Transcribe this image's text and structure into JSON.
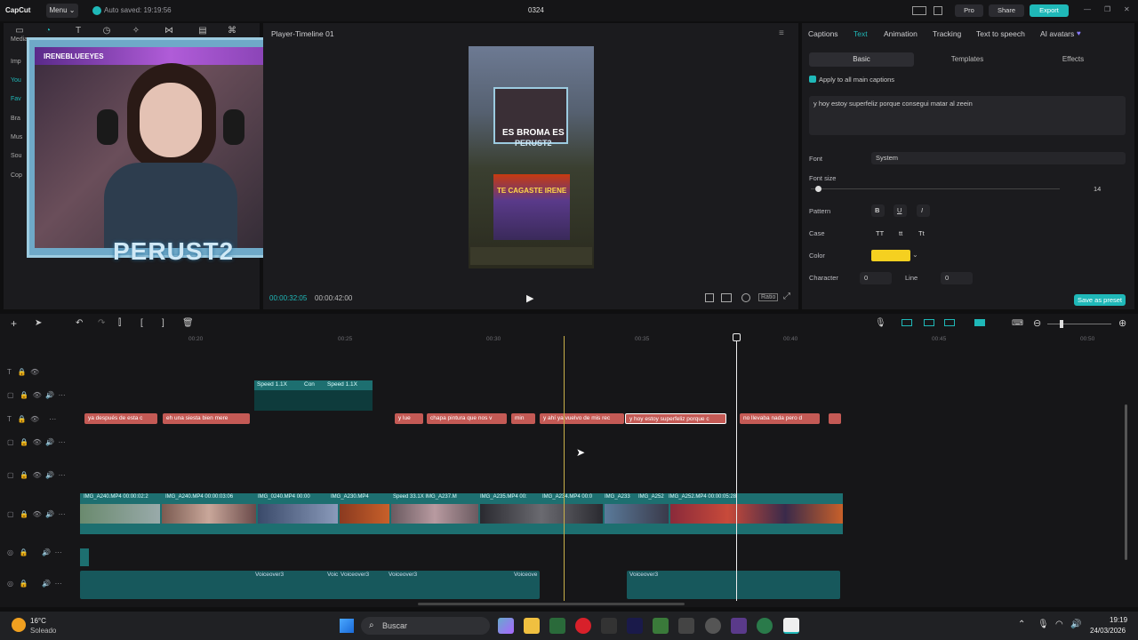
{
  "titlebar": {
    "app_name": "CapCut",
    "menu_label": "Menu",
    "autosave": "Auto saved: 19:19:56",
    "project_name": "0324",
    "pro_label": "Pro",
    "share_label": "Share",
    "export_label": "Export"
  },
  "media_panel": {
    "tab_label": "Media",
    "side_items": [
      "Imp",
      "You",
      "Fav",
      "Bra",
      "Mus",
      "Sou",
      "Cop"
    ]
  },
  "overlay": {
    "streamer_handle": "IRENEBLUEEYES",
    "overlay_title": "PERUST2"
  },
  "player": {
    "title": "Player-Timeline 01",
    "current_time": "00:00:32:05",
    "total_time": "00:00:42:00",
    "ratio_label": "Ratio",
    "caption_top": "ES BROMA ES",
    "caption_mid": "PERUST2",
    "caption_fire": "TE CAGASTE IRENE"
  },
  "right_panel": {
    "tabs": [
      "Captions",
      "Text",
      "Animation",
      "Tracking",
      "Text to speech",
      "AI avatars"
    ],
    "active_tab": "Text",
    "subtabs": [
      "Basic",
      "Templates",
      "Effects"
    ],
    "apply_all_label": "Apply to all main captions",
    "caption_text": "y hoy estoy superfeliz porque consegui matar al zeein",
    "font_label": "Font",
    "font_value": "System",
    "font_size_label": "Font size",
    "font_size_value": "14",
    "pattern_label": "Pattern",
    "case_label": "Case",
    "case_opts": [
      "TT",
      "tt",
      "Tt"
    ],
    "color_label": "Color",
    "color_value": "#f5d020",
    "character_label": "Character",
    "character_value": "0",
    "line_label": "Line",
    "line_value": "0",
    "save_preset_label": "Save as preset",
    "bold": "B",
    "underline": "U",
    "italic": "I"
  },
  "timeline": {
    "ruler": [
      "00:20",
      "00:25",
      "00:30",
      "00:35",
      "00:40",
      "00:45",
      "00:50"
    ],
    "speed_clips": [
      "Speed 1.1X",
      "Con",
      "Speed 1.1X"
    ],
    "captions": [
      "ya después de esta c",
      "eh una siesta bien mere",
      "y lue",
      "chapa pintura que nos v",
      "min",
      "y ahí ya vuelvo de mis rec",
      "y hoy estoy superfeliz porque c",
      "no llevaba nada pero d",
      ""
    ],
    "video_labels": [
      "IMG_A240.MP4  00:00:02:2",
      "IMG_A240.MP4  00:00:03:06",
      "IMG_0240.MP4  00:00",
      "IMG_A230.MP4",
      "Speed 33.1X  IMG_A237.M",
      "IMG_A235.MP4  00:",
      "IMG_A234.MP4  00:0",
      "IMG_A233",
      "IMG_A252",
      "IMG_A252.MP4  00:00:05:28"
    ],
    "audio_labels": [
      "Voiceover3",
      "Voic",
      "Voiceover3",
      "Voiceover3",
      "Voiceove",
      "Voiceover3"
    ]
  },
  "taskbar": {
    "weather_temp": "16°C",
    "weather_desc": "Soleado",
    "search_placeholder": "Buscar",
    "time": "19:19",
    "date": "24/03/2026"
  },
  "colors": {
    "accent": "#1fb8b8",
    "caption_clip": "#c45a55",
    "video_clip": "#1d6f70"
  }
}
